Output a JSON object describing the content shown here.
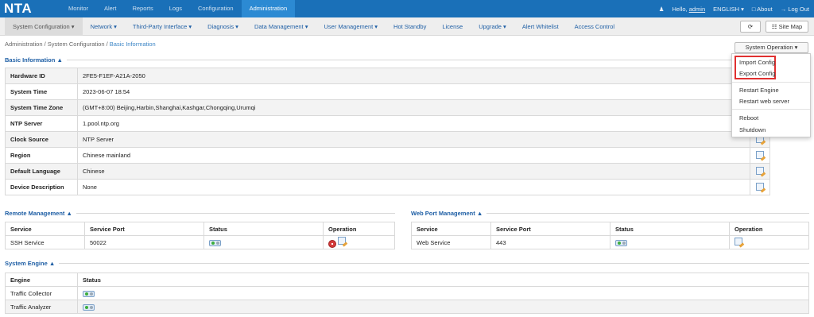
{
  "app": {
    "logo": "NTA"
  },
  "topnav": [
    "Monitor",
    "Alert",
    "Reports",
    "Logs",
    "Configuration",
    "Administration"
  ],
  "topright": {
    "hello": "Hello,",
    "user": "admin",
    "language": "ENGLISH ▾",
    "about": "About",
    "logout": "Log Out"
  },
  "subnav": [
    "System Configuration ▾",
    "Network ▾",
    "Third-Party Interface ▾",
    "Diagnosis ▾",
    "Data Management ▾",
    "User Management ▾",
    "Hot Standby",
    "License",
    "Upgrade ▾",
    "Alert Whitelist",
    "Access Control"
  ],
  "toolbar": {
    "refresh": "⟳",
    "sitemap": "Site Map"
  },
  "breadcrumb": [
    "Administration",
    "System Configuration",
    "Basic Information"
  ],
  "system_operation": {
    "label": "System Operation ▾",
    "menu": [
      "Import Config",
      "Export Config",
      "Restart Engine",
      "Restart web server",
      "Reboot",
      "Shutdown"
    ]
  },
  "basic_info": {
    "title": "Basic Information",
    "rows": [
      {
        "k": "Hardware ID",
        "v": "2FE5-F1EF-A21A-2050"
      },
      {
        "k": "System Time",
        "v": "2023-06-07 18:54"
      },
      {
        "k": "System Time Zone",
        "v": "(GMT+8:00) Beijing,Harbin,Shanghai,Kashgar,Chongqing,Urumqi"
      },
      {
        "k": "NTP Server",
        "v": "1.pool.ntp.org"
      },
      {
        "k": "Clock Source",
        "v": "NTP Server"
      },
      {
        "k": "Region",
        "v": "Chinese mainland"
      },
      {
        "k": "Default Language",
        "v": "Chinese"
      },
      {
        "k": "Device Description",
        "v": "None"
      }
    ]
  },
  "remote_mgmt": {
    "title": "Remote Management",
    "headers": [
      "Service",
      "Service Port",
      "Status",
      "Operation"
    ],
    "row": {
      "service": "SSH Service",
      "port": "50022"
    }
  },
  "web_mgmt": {
    "title": "Web Port Management",
    "headers": [
      "Service",
      "Service Port",
      "Status",
      "Operation"
    ],
    "row": {
      "service": "Web Service",
      "port": "443"
    }
  },
  "engine": {
    "title": "System Engine",
    "headers": [
      "Engine",
      "Status"
    ],
    "rows": [
      "Traffic Collector",
      "Traffic Analyzer"
    ]
  }
}
